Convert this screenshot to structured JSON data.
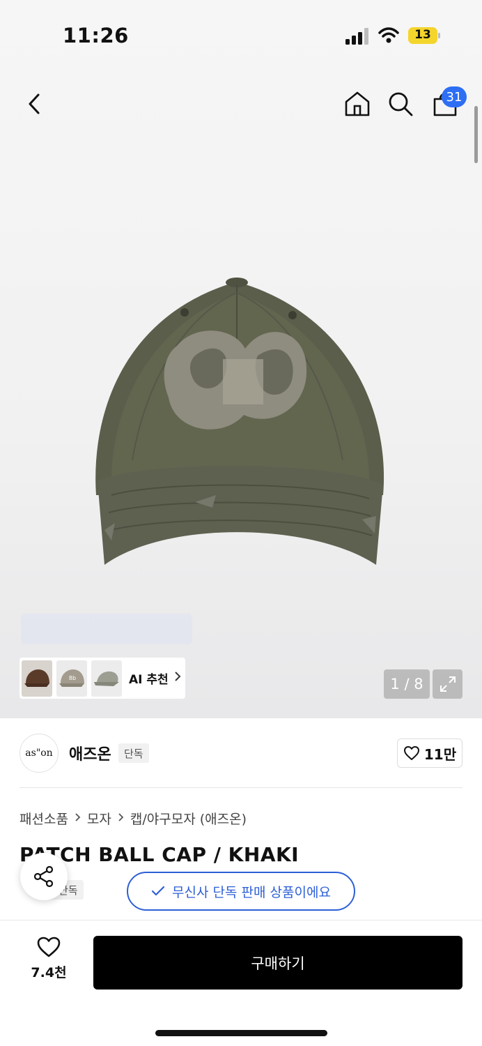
{
  "status_bar": {
    "time": "11:26",
    "battery": "13",
    "battery_color": "#f4d52c"
  },
  "top_nav": {
    "back_icon": "chevron-left-icon",
    "home_icon": "home-icon",
    "search_icon": "search-icon",
    "cart_icon": "shopping-bag-icon",
    "cart_count": "31",
    "badge_color": "#2d6ef3"
  },
  "gallery": {
    "image": "khaki-ball-cap-with-distressed-logo-patch",
    "recommend_label": "AI 추천",
    "page_counter": "1 / 8",
    "expand_icon": "expand-icon"
  },
  "brand": {
    "logo_text": "as\"on",
    "name": "애즈온",
    "exclusive_tag": "단독",
    "likes": "11만"
  },
  "product": {
    "breadcrumb": [
      "패션소품",
      "모자",
      "캡/야구모자 (애즈온)"
    ],
    "title": "PATCH BALL CAP / KHAKI",
    "exclusive_tag": "단독",
    "exclusive_notice": "무신사 단독 판매 상품이에요",
    "accent_color": "#2d5fd6"
  },
  "bottom_bar": {
    "wish_count": "7.4천",
    "buy_label": "구매하기"
  }
}
